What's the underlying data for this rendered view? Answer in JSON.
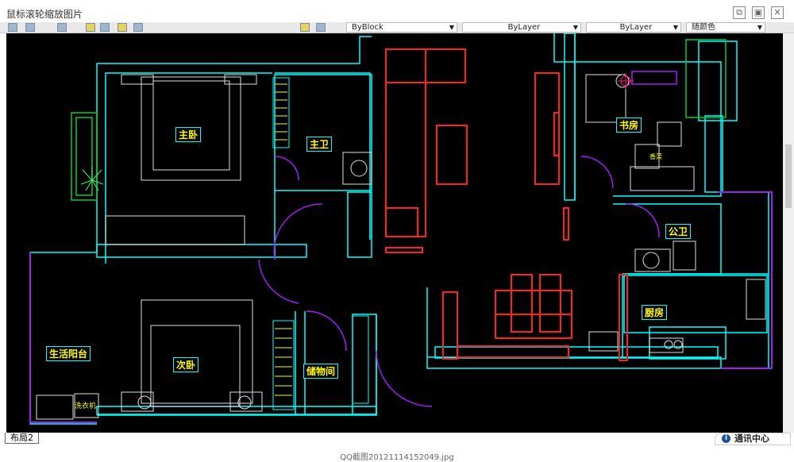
{
  "window": {
    "title": "鼠标滚轮缩放图片",
    "buttons": [
      "⧉",
      "▣",
      "✕"
    ]
  },
  "toolbar": {
    "block_select": "ByBlock",
    "layer_select_1": "ByLayer",
    "layer_select_2": "ByLayer",
    "color_select": "随颜色"
  },
  "rooms": {
    "master_bedroom": "主卧",
    "master_bath": "主卫",
    "study": "书房",
    "public_bath": "公卫",
    "kitchen": "厨房",
    "living_balcony": "生活阳台",
    "second_bedroom": "次卧",
    "storage": "储物间",
    "washer": "洗衣机",
    "plant": "香菜"
  },
  "status": {
    "layout_tab": "布局2",
    "notify": "通讯中心",
    "notify_icon": "i"
  },
  "footer": {
    "filename": "QQ截图20121114152049.jpg"
  },
  "colors": {
    "canvas": "#000000",
    "wall": "#00ffff",
    "furniture": "#ffffff",
    "door": "#a020f0",
    "highlight": "#ff2020",
    "label_text": "#ffff00",
    "greenery": "#00cc44"
  }
}
